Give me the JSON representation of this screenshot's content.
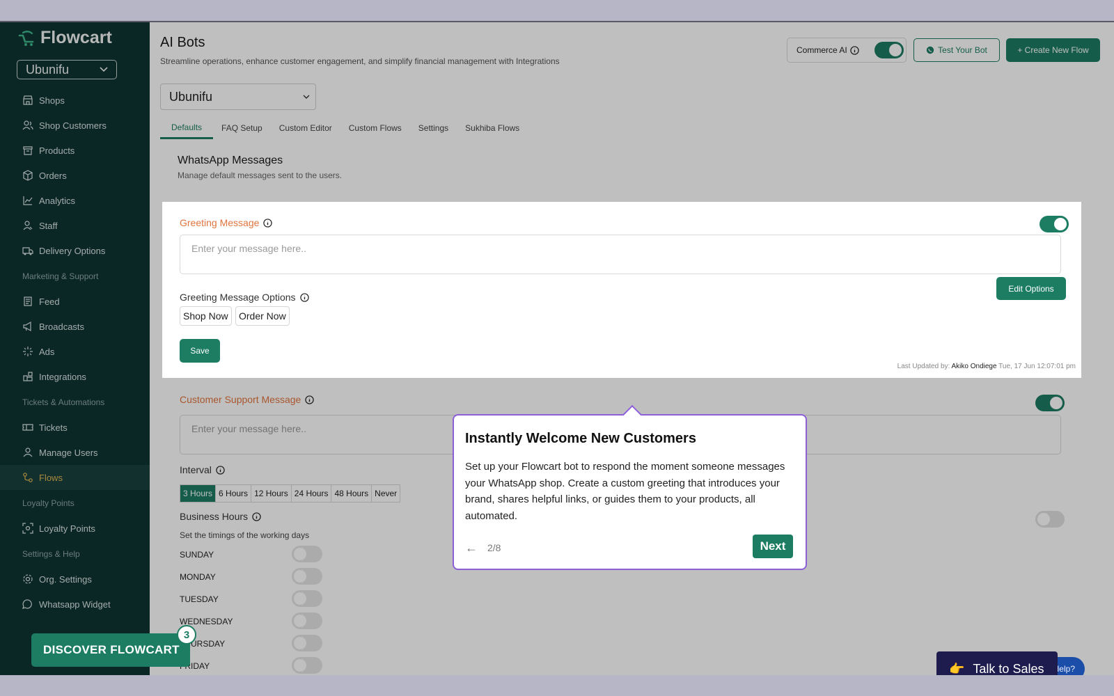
{
  "sidebar": {
    "brand": "Flowcart",
    "org": "Ubunifu",
    "items": [
      {
        "label": "Shops",
        "icon": "shop-icon"
      },
      {
        "label": "Shop Customers",
        "icon": "users-icon"
      },
      {
        "label": "Products",
        "icon": "archive-icon"
      },
      {
        "label": "Orders",
        "icon": "package-icon"
      },
      {
        "label": "Analytics",
        "icon": "chart-icon"
      },
      {
        "label": "Staff",
        "icon": "staff-icon"
      },
      {
        "label": "Delivery Options",
        "icon": "truck-icon"
      }
    ],
    "section_marketing": "Marketing & Support",
    "marketing_items": [
      {
        "label": "Feed",
        "icon": "newspaper-icon"
      },
      {
        "label": "Broadcasts",
        "icon": "megaphone-icon"
      },
      {
        "label": "Ads",
        "icon": "sparkle-icon"
      },
      {
        "label": "Integrations",
        "icon": "blocks-icon"
      }
    ],
    "section_tickets": "Tickets & Automations",
    "ticket_items": [
      {
        "label": "Tickets",
        "icon": "ticket-icon"
      },
      {
        "label": "Manage Users",
        "icon": "user-icon"
      },
      {
        "label": "Flows",
        "icon": "flow-icon"
      }
    ],
    "section_loyalty": "Loyalty Points",
    "loyalty_items": [
      {
        "label": "Loyalty Points",
        "icon": "scan-icon"
      }
    ],
    "section_settings": "Settings & Help",
    "settings_items": [
      {
        "label": "Org. Settings",
        "icon": "gear-icon"
      },
      {
        "label": "Whatsapp Widget",
        "icon": "chat-icon"
      }
    ],
    "discover_label": "DISCOVER FLOWCART",
    "discover_count": "3"
  },
  "header": {
    "title": "AI Bots",
    "subtitle": "Streamline operations, enhance customer engagement, and simplify financial management with Integrations",
    "commerce_label": "Commerce AI",
    "test_bot_label": "Test Your Bot",
    "create_flow_label": "+ Create New Flow"
  },
  "shop_select": "Ubunifu",
  "tabs": [
    "Defaults",
    "FAQ Setup",
    "Custom Editor",
    "Custom Flows",
    "Settings",
    "Sukhiba Flows"
  ],
  "section": {
    "title": "WhatsApp Messages",
    "subtitle": "Manage default messages sent to the users."
  },
  "greeting": {
    "label": "Greeting Message",
    "placeholder": "Enter your message here..",
    "options_label": "Greeting Message Options",
    "options": [
      "Shop Now",
      "Order Now"
    ],
    "edit_label": "Edit Options",
    "save_label": "Save",
    "updated_prefix": "Last Updated by:",
    "updated_by": "Akiko Ondiege",
    "updated_at": "Tue, 17 Jun 12:07:01 pm"
  },
  "support": {
    "label": "Customer Support Message",
    "placeholder": "Enter your message here..",
    "interval_label": "Interval",
    "intervals": [
      "3 Hours",
      "6 Hours",
      "12 Hours",
      "24 Hours",
      "48 Hours",
      "Never"
    ],
    "business_hours_label": "Business Hours",
    "business_hours_note": "Set the timings of the working days",
    "days": [
      "SUNDAY",
      "MONDAY",
      "TUESDAY",
      "WEDNESDAY",
      "THURSDAY",
      "FRIDAY"
    ]
  },
  "tour": {
    "title": "Instantly Welcome New Customers",
    "body": "Set up your Flowcart bot to respond the moment someone messages your WhatsApp shop. Create a custom greeting that introduces your brand, shares helpful links, or guides them to your products, all automated.",
    "back": "←",
    "progress": "2/8",
    "next_label": "Next"
  },
  "help_label": "Help?",
  "sales_label": "Talk to Sales",
  "sales_emoji": "👉",
  "colors": {
    "brand": "#1d7d63",
    "sidebar_bg": "#0e3432",
    "accent_orange": "#e1753f",
    "tour_border": "#8c5fd9"
  }
}
